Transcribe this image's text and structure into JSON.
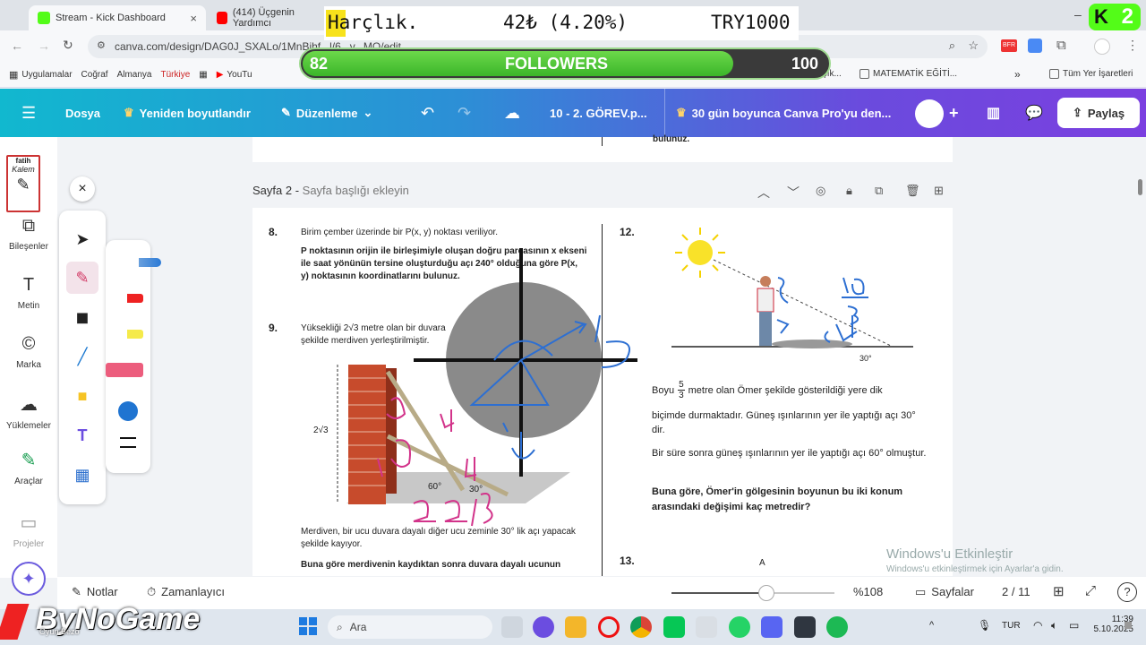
{
  "browser": {
    "tabs": [
      {
        "label": "Stream - Kick Dashboard",
        "color": "#53fc18"
      },
      {
        "label": "(414) Üçgenin Yardımcı",
        "color": "#ff0000"
      }
    ],
    "url": "canva.com/design/DAG0J_SXALo/1MnBjhf...l/6...v...MO/edit",
    "bookmarks": [
      "Uygulamalar",
      "Coğraf",
      "Almanya",
      "Türkiye",
      "YouTu",
      "Divan edebiyatı şık...",
      "MATEMATİK EĞİTİ...",
      "Tüm Yer İşaretleri"
    ]
  },
  "overlay": {
    "harclik_label": "Harçlık.",
    "harclik_amount": "42₺ (4.20%)",
    "harclik_goal": "TRY1000",
    "followers_current": "82",
    "followers_label": "FOLLOWERS",
    "followers_goal": "100",
    "followers_progress": 0.82,
    "k2": "2"
  },
  "canva_header": {
    "menu": "Dosya",
    "resize": "Yeniden boyutlandır",
    "edit": "Düzenleme",
    "title": "10 - 2. GÖREV.p...",
    "promo": "30 gün boyunca Canva Pro'yu den...",
    "share": "Paylaş"
  },
  "sidebar": {
    "brand_top": "fatih",
    "brand_bottom": "Kalem",
    "items": [
      "Bileşenler",
      "Metin",
      "Marka",
      "Yüklemeler",
      "Araçlar",
      "Projeler"
    ]
  },
  "page1": {
    "tail_text": "bulunuz."
  },
  "page2": {
    "header_prefix": "Sayfa 2 -",
    "header_placeholder": "Sayfa başlığı ekleyin",
    "q8": {
      "num": "8.",
      "line1": "Birim çember üzerinde bir P(x, y) noktası veriliyor.",
      "bold": "P noktasının orijin ile birleşimiyle oluşan doğru parçasının x ekseni ile saat yönünün tersine oluşturduğu açı 240° olduğuna göre P(x, y) noktasının koordinatlarını bulunuz."
    },
    "q9": {
      "num": "9.",
      "line1": "Yüksekliği 2√3 metre olan bir duvara",
      "line2": "şekilde merdiven yerleştirilmiştir.",
      "height_label": "2√3",
      "angle60": "60°",
      "angle30": "30°",
      "line3": "Merdiven, bir ucu duvara dayalı diğer ucu zeminle 30° lik açı yapacak şekilde kayıyor.",
      "bold": "Buna göre merdivenin kaydıktan sonra duvara dayalı ucunun"
    },
    "q12": {
      "num": "12.",
      "angle": "30°",
      "text1a": "Boyu",
      "frac_num": "5",
      "frac_den": "3",
      "text1b": "metre olan Ömer şekilde gösterildiği yere dik",
      "text2": "biçimde durmaktadır. Güneş ışınlarının yer ile yaptığı açı 30° dir.",
      "text3": "Bir süre sonra güneş ışınlarının yer ile yaptığı açı 60° olmuştur.",
      "bold": "Buna göre, Ömer'in gölgesinin boyunun bu iki konum arasındaki değişimi kaç metredir?"
    },
    "q13": {
      "num": "13.",
      "point": "A"
    }
  },
  "bottombar": {
    "notes": "Notlar",
    "timer": "Zamanlayıcı",
    "zoom": "%108",
    "zoom_level": 0.58,
    "pages": "Sayfalar",
    "page_count": "2 / 11"
  },
  "watermark": {
    "line1": "Windows'u Etkinleştir",
    "line2": "Windows'u etkinleştirmek için Ayarlar'a gidin."
  },
  "taskbar": {
    "search": "Ara",
    "lang": "TUR",
    "time": "11:39",
    "date": "5.10.2025",
    "stream_logo": "ByNoGame",
    "stream_sub": "Oyun Bezo"
  }
}
